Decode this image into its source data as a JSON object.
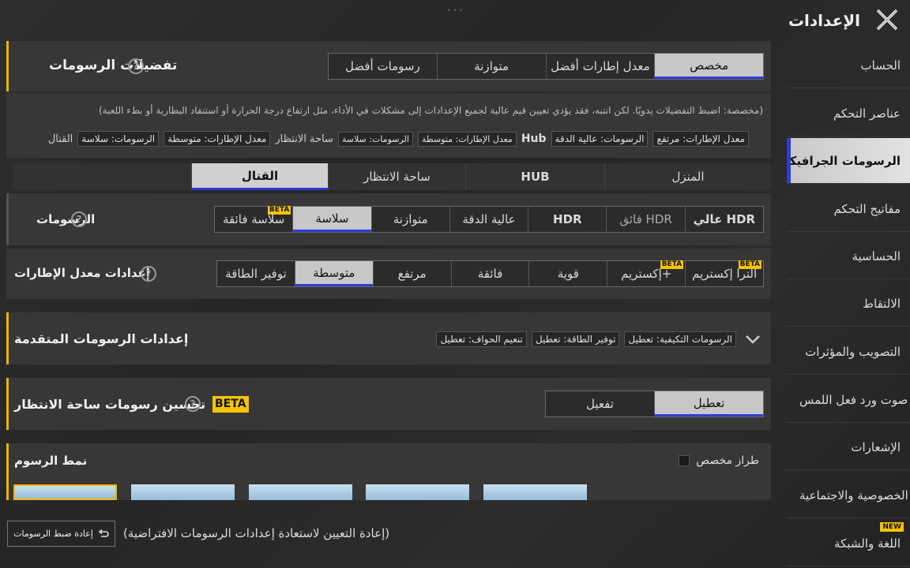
{
  "header": {
    "title": "الإعدادات"
  },
  "sidebar": {
    "items": [
      {
        "label": "الحساب"
      },
      {
        "label": "عناصر التحكم"
      },
      {
        "label": "الرسومات الجرافيكية"
      },
      {
        "label": "مفاتيح التحكم"
      },
      {
        "label": "الحساسية"
      },
      {
        "label": "الالتقاط"
      },
      {
        "label": "التصويب والمؤثرات"
      },
      {
        "label": "صوت ورد فعل اللمس"
      },
      {
        "label": "الإشعارات"
      },
      {
        "label": "الخصوصية والاجتماعية"
      },
      {
        "label": "اللغة والشبكة",
        "badge": "NEW"
      }
    ]
  },
  "prefs": {
    "title": "تفضيلات الرسومات",
    "options": [
      "مخصص",
      "معدل إطارات أفضل",
      "متوازنة",
      "رسومات أفضل"
    ],
    "selected": "مخصص",
    "note": "(مخصصة: اضبط التفضيلات يدويًا. لكن انتبه، فقد يؤدي تعيين قيم عالية لجميع الإعدادات إلى مشكلات في الأداء، مثل ارتفاع درجة الحرارة أو استنفاد البطارية أو بطء اللعبة)",
    "summary": {
      "hub_fps": "معدل الإطارات: مرتفع",
      "hub_gfx": "الرسومات: عالية الدقة",
      "hub_label": "Hub",
      "lobby_fps": "معدل الإطارات: متوسطة",
      "lobby_gfx": "الرسومات: سلاسة",
      "lobby_label": "ساحة الانتظار",
      "combat_fps": "معدل الإطارات: متوسطة",
      "combat_gfx": "الرسومات: سلاسة",
      "combat_label": "القتال"
    }
  },
  "tabs": {
    "items": [
      "المنزل",
      "HUB",
      "ساحة الانتظار",
      "القتال"
    ],
    "selected": "القتال"
  },
  "graphics": {
    "label": "الرسومات",
    "options": [
      {
        "label": "عالي HDR"
      },
      {
        "label": "فائق HDR"
      },
      {
        "label": "HDR"
      },
      {
        "label": "عالية الدقة"
      },
      {
        "label": "متوازنة"
      },
      {
        "label": "سلاسة"
      },
      {
        "label": "سلاسة فائقة",
        "badge": "BETA"
      }
    ],
    "selected": "سلاسة"
  },
  "fps": {
    "label": "إعدادات معدل الإطارات",
    "options": [
      {
        "label": "ألترا إكستريم",
        "badge": "BETA"
      },
      {
        "label": "إكستريم+",
        "badge": "BETA"
      },
      {
        "label": "قوية"
      },
      {
        "label": "فائقة"
      },
      {
        "label": "مرتفع"
      },
      {
        "label": "متوسطة"
      },
      {
        "label": "توفير الطاقة"
      }
    ],
    "selected": "متوسطة"
  },
  "advanced": {
    "title": "إعدادات الرسومات المتقدمة",
    "tags": [
      "الرسومات التكيفية: تعطيل",
      "توفير الطاقة: تعطيل",
      "تنعيم الحواف: تعطيل"
    ]
  },
  "lobby_enhance": {
    "title": "تحسين رسومات ساحة الانتظار",
    "badge": "BETA",
    "options": [
      "تعطيل",
      "تفعيل"
    ],
    "selected": "تعطيل"
  },
  "style": {
    "title": "نمط الرسوم",
    "custom_label": "طراز مخصص"
  },
  "footer": {
    "reset_button": "إعادة ضبط الرسومات",
    "reset_note": "(إعادة التعيين لاستعادة إعدادات الرسومات الافتراضية)"
  }
}
